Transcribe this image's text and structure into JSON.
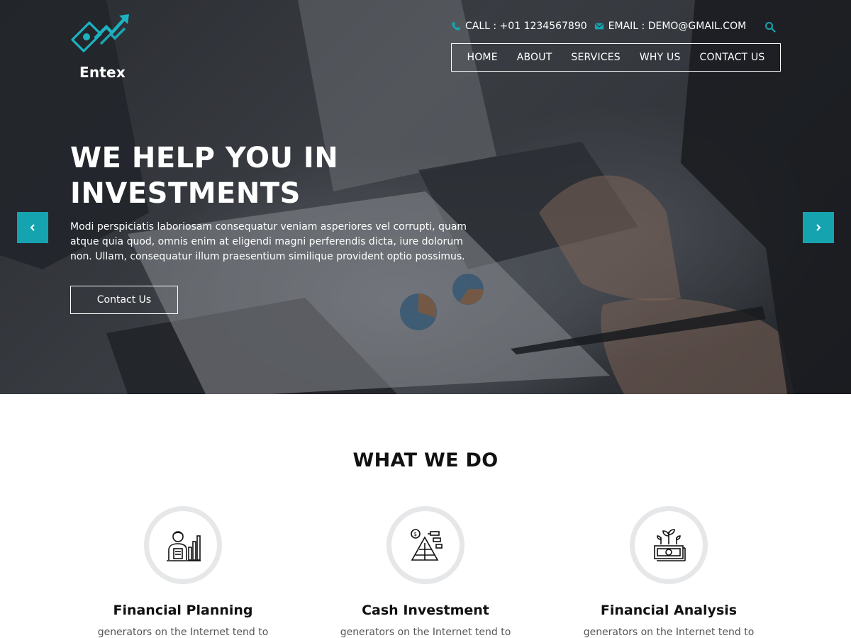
{
  "brand": {
    "name": "Entex"
  },
  "topbar": {
    "call_text": "CALL : +01 1234567890",
    "email_text": "EMAIL : DEMO@GMAIL.COM"
  },
  "nav": {
    "items": [
      "HOME",
      "ABOUT",
      "SERVICES",
      "WHY US",
      "CONTACT US"
    ]
  },
  "hero": {
    "title_line1": "WE HELP YOU IN",
    "title_line2": "INVESTMENTS",
    "description": "Modi perspiciatis laboriosam consequatur veniam asperiores vel corrupti, quam atque quia quod, omnis enim at eligendi magni perferendis dicta, iure dolorum non. Ullam, consequatur illum praesentium similique provident optio possimus.",
    "button_label": "Contact Us"
  },
  "services": {
    "title": "WHAT WE DO",
    "items": [
      {
        "title": "Financial Planning",
        "text": "generators on the Internet tend to"
      },
      {
        "title": "Cash Investment",
        "text": "generators on the Internet tend to"
      },
      {
        "title": "Financial Analysis",
        "text": "generators on the Internet tend to"
      }
    ]
  },
  "colors": {
    "accent": "#16a3b0",
    "hero_overlay": "#14161a",
    "circle_border": "#e6e7e9"
  },
  "icons": {
    "call": "phone-icon",
    "email": "envelope-icon",
    "search": "search-icon",
    "prev": "chevron-left-icon",
    "next": "chevron-right-icon",
    "service_1": "advisor-chart-icon",
    "service_2": "pyramid-investment-icon",
    "service_3": "money-plant-icon"
  }
}
